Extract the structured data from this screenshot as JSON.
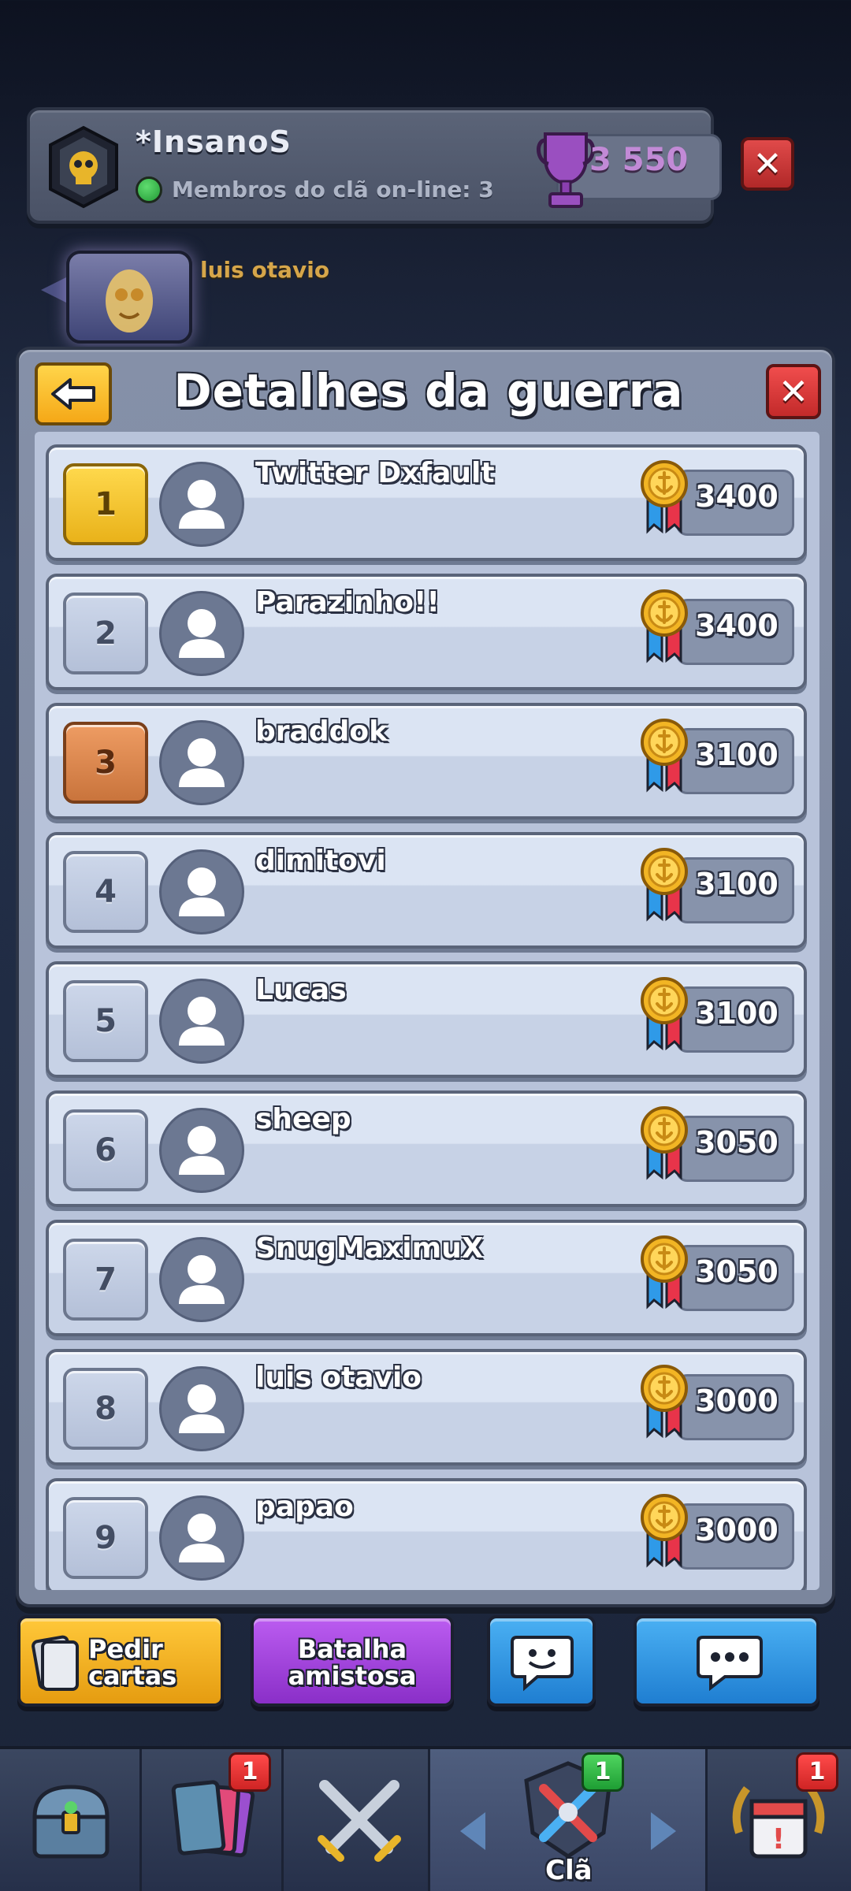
{
  "clan": {
    "name": "*InsanoS",
    "online_text": "Membros do clã on-line: 3",
    "trophies": "3 550"
  },
  "chat": {
    "sender_name": "luis otavio"
  },
  "panel": {
    "title": "Detalhes da guerra"
  },
  "players": [
    {
      "rank": "1",
      "name": "Twitter Dxfault",
      "score": "3400",
      "rank_style": "gold"
    },
    {
      "rank": "2",
      "name": "Parazinho!!",
      "score": "3400",
      "rank_style": "silver"
    },
    {
      "rank": "3",
      "name": "braddok",
      "score": "3100",
      "rank_style": "bronze"
    },
    {
      "rank": "4",
      "name": "dimitovi",
      "score": "3100",
      "rank_style": "normal"
    },
    {
      "rank": "5",
      "name": "Lucas",
      "score": "3100",
      "rank_style": "normal"
    },
    {
      "rank": "6",
      "name": "sheep",
      "score": "3050",
      "rank_style": "normal"
    },
    {
      "rank": "7",
      "name": "SnugMaximuX",
      "score": "3050",
      "rank_style": "normal"
    },
    {
      "rank": "8",
      "name": "luis otavio",
      "score": "3000",
      "rank_style": "normal"
    },
    {
      "rank": "9",
      "name": "papao",
      "score": "3000",
      "rank_style": "normal"
    }
  ],
  "actions": {
    "pedir_line1": "Pedir",
    "pedir_line2": "cartas",
    "batalha_line1": "Batalha",
    "batalha_line2": "amistosa"
  },
  "bottom_nav": {
    "cards_badge": "1",
    "clan_badge": "1",
    "events_badge": "1",
    "clan_label": "Clã"
  },
  "colors": {
    "gold_rank": "#ffd94d",
    "bronze_rank": "#ee9c63",
    "close_red": "#e04a4a",
    "yellow_button": "#ffc83a",
    "purple_button": "#bb5cf0",
    "blue_button": "#4ab0f3"
  }
}
